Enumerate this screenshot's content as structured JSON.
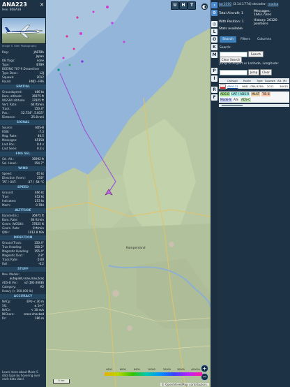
{
  "aircraft": {
    "callsign": "ANA223",
    "hex_label": "Hex: 86BA38",
    "photo_caption": "Image © Oleh Photography",
    "close_icon": "close-x"
  },
  "details": [
    {
      "k": "Reg.:",
      "v": "JA878A"
    },
    {
      "k": "",
      "v": "Japan"
    },
    {
      "k": "DB flags:",
      "v": "none"
    },
    {
      "k": "Type:",
      "v": "B789"
    },
    {
      "k": "BOEING 787-9 Dreamliner",
      "v": ""
    },
    {
      "k": "Type Desc.:",
      "v": "L2J"
    },
    {
      "k": "Squawk:",
      "v": "2012"
    },
    {
      "k": "Route:",
      "v": "HND - FRA"
    }
  ],
  "sections": {
    "spatial": "SPATIAL",
    "signal": "SIGNAL",
    "fms": "FMS SEL",
    "wind": "WIND",
    "speed": "SPEED",
    "altitude": "ALTITUDE",
    "direction": "DIRECTION",
    "stuff": "STUFF",
    "accuracy": "ACCURACY"
  },
  "spatial": [
    {
      "k": "Groundspeed:",
      "v": "466 kt"
    },
    {
      "k": "Baro. altitude:",
      "v": "36975 ft"
    },
    {
      "k": "WGS84 altitude:",
      "v": "37825 ft"
    },
    {
      "k": "Vert. Rate:",
      "v": "64 ft/min"
    },
    {
      "k": "Track:",
      "v": "150.4°"
    },
    {
      "k": "Pos.:",
      "v": "52.754°, 5.815°"
    },
    {
      "k": "Distance:",
      "v": "25.8 nmi"
    }
  ],
  "signal": [
    {
      "k": "Source:",
      "v": "ADS-B"
    },
    {
      "k": "RSSI:",
      "v": "-7.3"
    },
    {
      "k": "Msg. Rate:",
      "v": "40.5"
    },
    {
      "k": "Messages:",
      "v": "65158"
    },
    {
      "k": "Last Pos.:",
      "v": "0.4 s"
    },
    {
      "k": "Last Seen:",
      "v": "0.3 s"
    }
  ],
  "fms": [
    {
      "k": "Sel. Alt.:",
      "v": "36992 ft"
    },
    {
      "k": "Sel. Head.:",
      "v": "154.7°"
    }
  ],
  "wind": [
    {
      "k": "Speed:",
      "v": "65 kt"
    },
    {
      "k": "Direction (from):",
      "v": "258°"
    },
    {
      "k": "TAT / OAT:",
      "v": "-27 / -54 °C"
    }
  ],
  "speed": [
    {
      "k": "Ground:",
      "v": "466 kt"
    },
    {
      "k": "True:",
      "v": "452 kt"
    },
    {
      "k": "Indicated:",
      "v": "253 kt"
    },
    {
      "k": "Mach:",
      "v": "0.784"
    }
  ],
  "altitude": [
    {
      "k": "Barometric:",
      "v": "36975 ft"
    },
    {
      "k": "Baro. Rate:",
      "v": "64 ft/min"
    },
    {
      "k": "Geom. WGS84:",
      "v": "37825 ft"
    },
    {
      "k": "Geom. Rate:",
      "v": "0 ft/min"
    },
    {
      "k": "QNH:",
      "v": "1012.8 hPa"
    }
  ],
  "direction": [
    {
      "k": "Ground Track:",
      "v": "150.4°"
    },
    {
      "k": "True Heading:",
      "v": "158.2°"
    },
    {
      "k": "Magnetic Heading:",
      "v": "155.4°"
    },
    {
      "k": "Magnetic Decl.:",
      "v": "2.8°"
    },
    {
      "k": "Track Rate:",
      "v": "0.00"
    },
    {
      "k": "Roll:",
      "v": "-0.2"
    }
  ],
  "stuff": [
    {
      "k": "Nav. Modes:",
      "v": ""
    },
    {
      "k": "",
      "v": "autopilot,vnav,lnav,tcas"
    },
    {
      "k": "ADS-B Ver.:",
      "v": "v2 (DO-260B)"
    },
    {
      "k": "Category:",
      "v": "A5"
    },
    {
      "k": "Heavy (> 300,000 lb)",
      "v": ""
    }
  ],
  "accuracy": [
    {
      "k": "NACp:",
      "v": "EPU < 30 m"
    },
    {
      "k": "SIL:",
      "v": "≤ 1e-7"
    },
    {
      "k": "NACv:",
      "v": "< 10 m/s"
    },
    {
      "k": "NICbaro:",
      "v": "cross-checked"
    },
    {
      "k": "Rc:",
      "v": "186 m"
    }
  ],
  "note": "Learn more about Mode S data type by hovering over each data label.",
  "map": {
    "top_buttons": [
      "U",
      "H",
      "T"
    ],
    "left_arrow": "◀",
    "zoom_in": "+",
    "zoom_out": "−",
    "scale_label": "5 km",
    "attribution": "© OpenStreetMap contributors.",
    "town_label": "Kampenland",
    "alt_labels": [
      "4000",
      "6000",
      "8000",
      "10000",
      "20000",
      "30000",
      "40000+"
    ],
    "colors": {
      "track": "#9b59d6",
      "water": "#93b5d9",
      "land": "#b8c8a4"
    }
  },
  "side_buttons": [
    "",
    "L",
    "O",
    "K",
    "M",
    "P",
    "I",
    "R"
  ],
  "right": {
    "version_prefix": "",
    "version_link": "tar1090",
    "version_rest": "(3.14.1774) decoder:",
    "decoder_link": "readsb",
    "total_aircraft": "Total Aircraft: 1",
    "messages": "Messages: 1663.7/sec",
    "with_position": "With Position: 1",
    "history": "History: 26120 positions",
    "stats_label": "Stats available",
    "tabs": [
      "Search",
      "Filters",
      "Columns"
    ],
    "search_label": "Search:",
    "search_btn": "Search",
    "clear_search_btn": "Clear Search",
    "jump_label": "Jump to Airport or Latitude, Longitude:",
    "jump_btn": "Jump",
    "clear_btn": "Clear",
    "table_headers": [
      "Callsign",
      "Route",
      "Type",
      "Squawk",
      "Alt. (ft)"
    ],
    "table_row": [
      "ANA223",
      "HND - FRA",
      "B789",
      "2012",
      "36975"
    ],
    "sources": [
      {
        "label": "ADS-B",
        "color": "#a3e08e"
      },
      {
        "label": "UAT / ADS-R",
        "color": "#9ee7e4"
      },
      {
        "label": "MLAT",
        "color": "#e8d0a3"
      },
      {
        "label": "TIS-B",
        "color": "#f7c6a8"
      },
      {
        "label": "Mode-S",
        "color": "#c8d0ff"
      },
      {
        "label": "AIS",
        "color": "#f5f5f5"
      },
      {
        "label": "ADS-C",
        "color": "#c4e8b8"
      }
    ]
  }
}
